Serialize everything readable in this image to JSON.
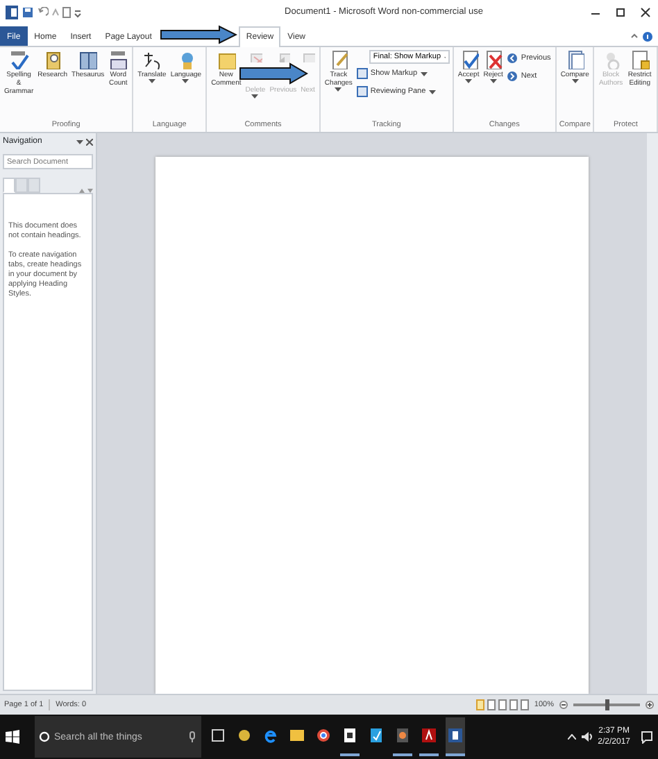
{
  "window": {
    "title": "Document1 - Microsoft Word non-commercial use"
  },
  "tabs": [
    {
      "label": "File",
      "kind": "file",
      "selected": false
    },
    {
      "label": "Home",
      "kind": "tab",
      "selected": false
    },
    {
      "label": "Insert",
      "kind": "tab",
      "selected": false
    },
    {
      "label": "Page Layout",
      "kind": "tab",
      "selected": false
    },
    {
      "label": "Review",
      "kind": "tab",
      "selected": true
    },
    {
      "label": "View",
      "kind": "tab",
      "selected": false
    }
  ],
  "ribbon_groups": [
    {
      "label": "Proofing",
      "buttons": [
        {
          "kind": "large",
          "label": "Spelling & Grammar",
          "disabled": false,
          "dropdown": false
        },
        {
          "kind": "large",
          "label": "Research",
          "disabled": false,
          "dropdown": false
        },
        {
          "kind": "large",
          "label": "Thesaurus",
          "disabled": false,
          "dropdown": false
        },
        {
          "kind": "large",
          "label": "Word Count",
          "disabled": false,
          "dropdown": false
        }
      ]
    },
    {
      "label": "Language",
      "buttons": [
        {
          "kind": "large",
          "label": "Translate",
          "disabled": false,
          "dropdown": true
        },
        {
          "kind": "large",
          "label": "Language",
          "disabled": false,
          "dropdown": true
        }
      ]
    },
    {
      "label": "Comments",
      "buttons": [
        {
          "kind": "large",
          "label": "New Comment",
          "disabled": false,
          "dropdown": false
        },
        {
          "kind": "compact",
          "label": "Delete",
          "disabled": true,
          "dropdown": true
        },
        {
          "kind": "compact",
          "label": "Previous",
          "disabled": true,
          "dropdown": false
        },
        {
          "kind": "compact",
          "label": "Next",
          "disabled": true,
          "dropdown": false
        }
      ]
    },
    {
      "label": "Tracking",
      "buttons": [
        {
          "kind": "large",
          "label": "Track Changes",
          "disabled": false,
          "dropdown": true
        },
        {
          "kind": "stack",
          "items": [
            {
              "kind": "select",
              "label": "Final: Show Markup"
            },
            {
              "kind": "small",
              "label": "Show Markup"
            },
            {
              "kind": "small",
              "label": "Reviewing Pane"
            }
          ]
        }
      ]
    },
    {
      "label": "Changes",
      "buttons": [
        {
          "kind": "large",
          "label": "Accept",
          "disabled": false,
          "dropdown": true
        },
        {
          "kind": "large",
          "label": "Reject",
          "disabled": false,
          "dropdown": true
        },
        {
          "kind": "stack",
          "items": [
            {
              "kind": "plain",
              "label": "Previous"
            },
            {
              "kind": "plain",
              "label": "Next"
            }
          ]
        }
      ]
    },
    {
      "label": "Compare",
      "buttons": [
        {
          "kind": "large",
          "label": "Compare",
          "disabled": false,
          "dropdown": true
        }
      ]
    },
    {
      "label": "Protect",
      "buttons": [
        {
          "kind": "large",
          "label": "Block Authors",
          "disabled": true,
          "dropdown": false
        },
        {
          "kind": "large",
          "label": "Restrict Editing",
          "disabled": false,
          "dropdown": false
        }
      ]
    }
  ],
  "navigation": {
    "title": "Navigation",
    "search": {
      "placeholder": "Search Document"
    },
    "views": [
      {
        "selected": true
      },
      {
        "selected": false
      },
      {
        "selected": false
      }
    ],
    "messages": [
      "This document does not contain headings.",
      "To create navigation tabs, create headings in your document by applying Heading Styles."
    ]
  },
  "status_bar": {
    "page": "Page 1 of 1",
    "words": "Words: 0",
    "zoom": "100%",
    "zoom_level": {
      "level": 0.5
    }
  },
  "taskbar": {
    "search": {
      "placeholder": "Search all the things"
    },
    "apps": [
      {
        "running": false
      },
      {
        "running": false
      },
      {
        "running": false
      },
      {
        "running": false
      },
      {
        "running": false
      },
      {
        "running": true
      },
      {
        "running": false
      },
      {
        "running": true
      },
      {
        "running": true
      },
      {
        "running": true
      }
    ],
    "time": "2:37 PM",
    "date": "2/2/2017"
  }
}
